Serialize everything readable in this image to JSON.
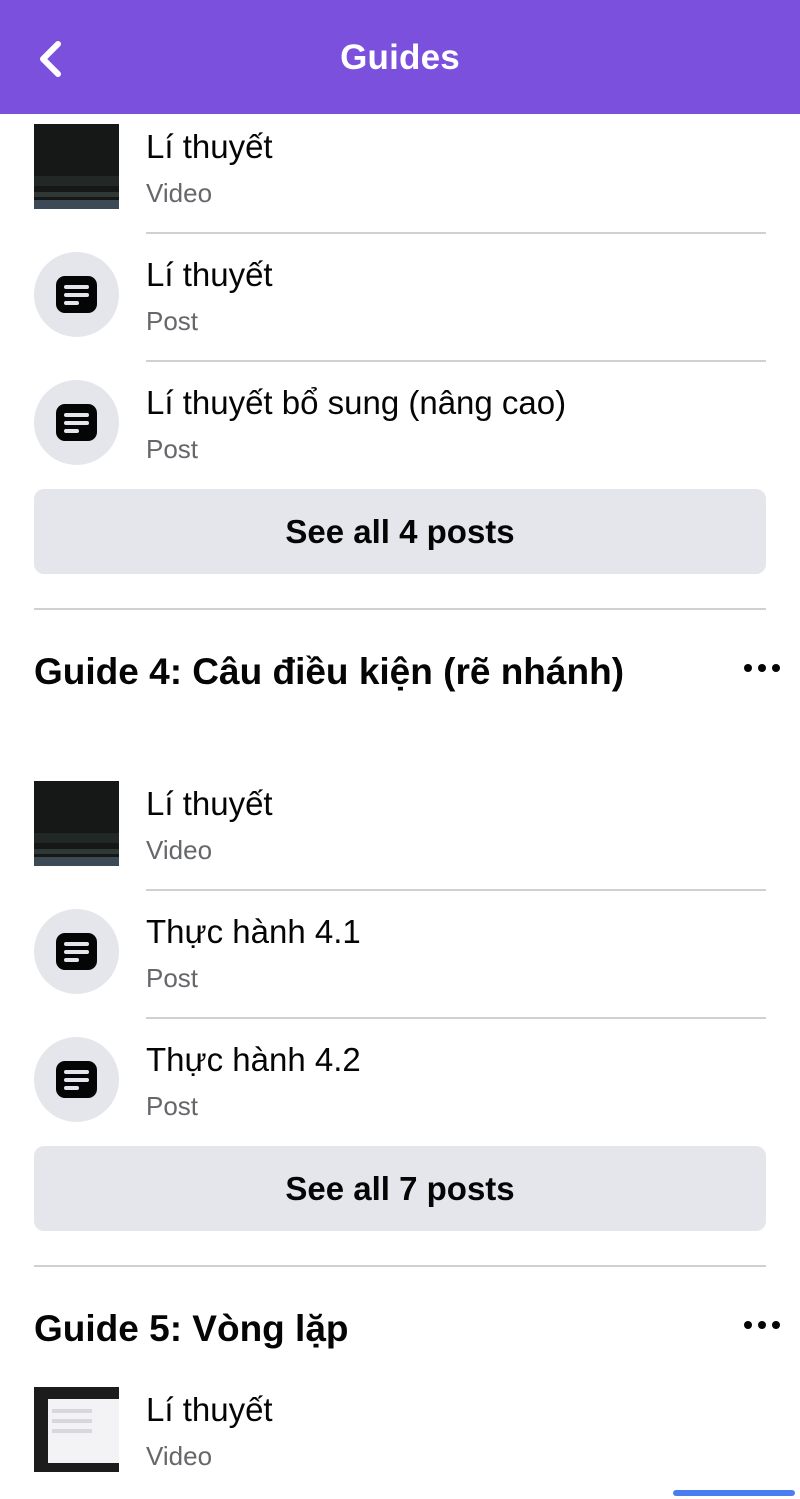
{
  "header": {
    "title": "Guides",
    "back_icon": "chevron-left-icon"
  },
  "colors": {
    "header_bg": "#7b50dd",
    "button_bg": "#e4e6eb",
    "secondary_text": "#65676b"
  },
  "top_section": {
    "items": [
      {
        "title": "Lí thuyết",
        "type": "Video"
      },
      {
        "title": "Lí thuyết",
        "type": "Post"
      },
      {
        "title": "Lí thuyết bổ sung (nâng cao)",
        "type": "Post"
      }
    ],
    "see_all_label": "See all 4 posts"
  },
  "guide4": {
    "title": "Guide 4: Câu điều kiện (rẽ nhánh)",
    "items": [
      {
        "title": "Lí thuyết",
        "type": "Video"
      },
      {
        "title": "Thực hành 4.1",
        "type": "Post"
      },
      {
        "title": "Thực hành 4.2",
        "type": "Post"
      }
    ],
    "see_all_label": "See all 7 posts"
  },
  "guide5": {
    "title": "Guide 5: Vòng lặp",
    "items": [
      {
        "title": "Lí thuyết",
        "type": "Video"
      }
    ]
  }
}
